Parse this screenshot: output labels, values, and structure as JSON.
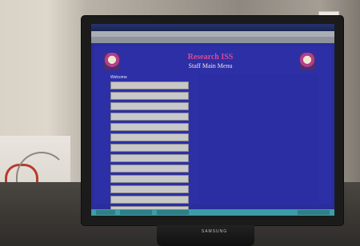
{
  "window": {
    "title": ""
  },
  "app": {
    "title": "Research ISS",
    "subtitle": "Staff Main Menu",
    "menu_heading": "Welcome"
  },
  "menu_items": [
    {
      "label": ""
    },
    {
      "label": ""
    },
    {
      "label": ""
    },
    {
      "label": ""
    },
    {
      "label": ""
    },
    {
      "label": ""
    },
    {
      "label": ""
    },
    {
      "label": ""
    },
    {
      "label": ""
    },
    {
      "label": ""
    },
    {
      "label": ""
    },
    {
      "label": ""
    },
    {
      "label": ""
    },
    {
      "label": ""
    }
  ],
  "monitor": {
    "brand": "SAMSUNG"
  },
  "colors": {
    "screen_bg": "#1f2a87",
    "content_bg": "#2d2fa6",
    "title_accent": "#d84b91",
    "button_gray": "#c8c8c8",
    "status_bar": "#3b9da6"
  },
  "icons": {
    "logo_left": "crest-icon",
    "logo_right": "crest-icon"
  }
}
